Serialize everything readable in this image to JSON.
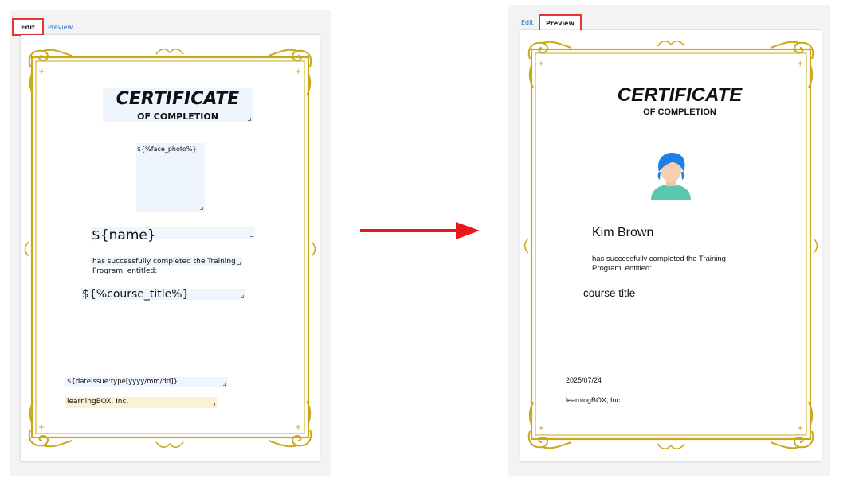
{
  "editor": {
    "tabs": {
      "edit": "Edit",
      "preview": "Preview"
    },
    "certificate": {
      "title": "CERTIFICATE",
      "subtitle": "OF COMPLETION",
      "photo_placeholder": "${%face_photo%}",
      "name_placeholder": "${name}",
      "body_line1": "has successfully completed the Training",
      "body_line2": "Program, entitled:",
      "course_placeholder": "${%course_title%}",
      "date_placeholder": "${dateIssue:type[yyyy/mm/dd]}",
      "company": "learningBOX, Inc."
    }
  },
  "preview": {
    "tabs": {
      "edit": "Edit",
      "preview": "Preview"
    },
    "certificate": {
      "title": "CERTIFICATE",
      "subtitle": "OF COMPLETION",
      "name": "Kim Brown",
      "body_line1": "has successfully completed the Training",
      "body_line2": "Program, entitled:",
      "course_title": "course title",
      "date": "2025/07/24",
      "company": "learningBOX, Inc."
    }
  },
  "colors": {
    "frame_gold": "#c9a81a",
    "highlight_red": "#e53535",
    "arrow_red": "#e8191c",
    "field_blue": "#eef5fc",
    "field_yellow": "#fbf1d3",
    "link_blue": "#2a6fd0"
  },
  "icons": [
    "avatar-icon",
    "red-arrow-icon",
    "gold-frame"
  ]
}
